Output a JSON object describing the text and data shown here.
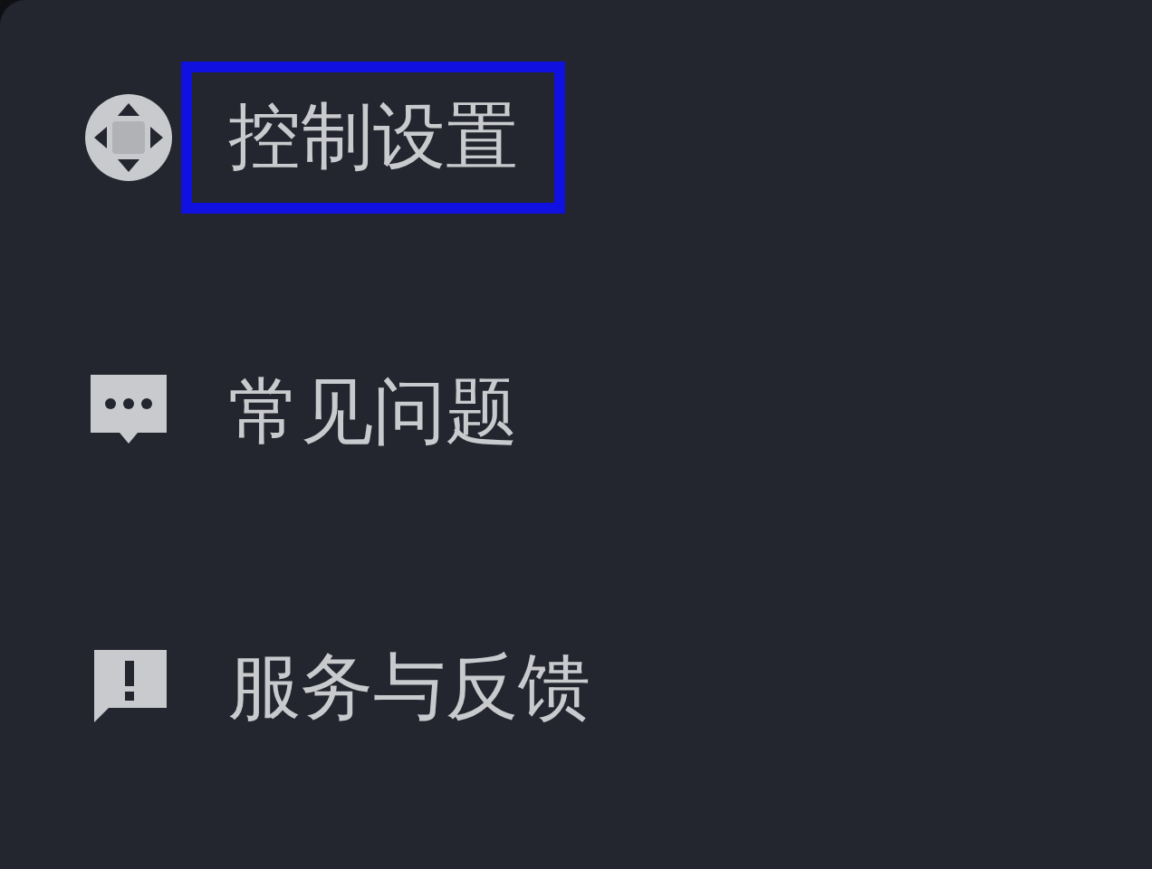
{
  "menu": {
    "items": [
      {
        "label": "控制设置",
        "kind": "dpad",
        "highlighted": true
      },
      {
        "label": "常见问题",
        "kind": "chat",
        "highlighted": false
      },
      {
        "label": "服务与反馈",
        "kind": "alert",
        "highlighted": false
      }
    ]
  }
}
